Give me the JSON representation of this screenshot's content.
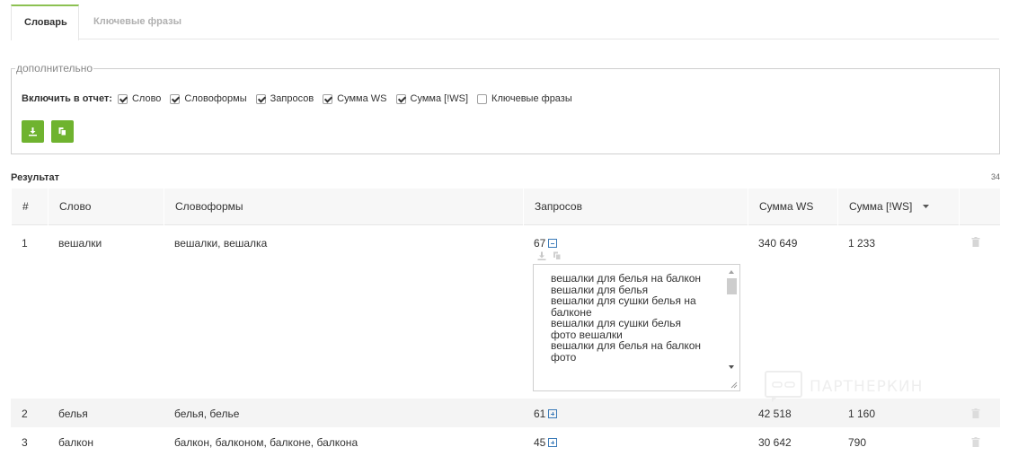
{
  "tabs": [
    {
      "label": "Словарь",
      "active": true
    },
    {
      "label": "Ключевые фразы",
      "active": false
    }
  ],
  "options": {
    "legend": "дополнительно",
    "include_label": "Включить в отчет:",
    "checkboxes": [
      {
        "label": "Слово",
        "checked": true
      },
      {
        "label": "Словоформы",
        "checked": true
      },
      {
        "label": "Запросов",
        "checked": true
      },
      {
        "label": "Сумма WS",
        "checked": true
      },
      {
        "label": "Сумма [!WS]",
        "checked": true
      },
      {
        "label": "Ключевые фразы",
        "checked": false
      }
    ],
    "buttons": [
      {
        "icon": "download-icon"
      },
      {
        "icon": "copy-icon"
      }
    ]
  },
  "result": {
    "title": "Результат",
    "count": "34"
  },
  "table": {
    "headers": [
      "#",
      "Слово",
      "Словоформы",
      "Запросов",
      "Сумма WS",
      "Сумма [!WS]"
    ],
    "sort_icon": "sort-desc-icon",
    "rows": [
      {
        "num": "1",
        "word": "вешалки",
        "forms": "вешалки, вешалка",
        "queries": "67",
        "expanded": true,
        "ws": "340 649",
        "ws_excl": "1 233"
      },
      {
        "num": "2",
        "word": "белья",
        "forms": "белья, белье",
        "queries": "61",
        "expanded": false,
        "ws": "42 518",
        "ws_excl": "1 160"
      },
      {
        "num": "3",
        "word": "балкон",
        "forms": "балкон, балконом, балконе, балкона",
        "queries": "45",
        "expanded": false,
        "ws": "30 642",
        "ws_excl": "790"
      }
    ],
    "phrases": [
      "вешалки для белья на балкон",
      "вешалки для белья",
      "вешалки для сушки белья на балконе",
      "вешалки для сушки белья",
      "фото вешалки",
      "вешалки для белья на балкон фото"
    ]
  },
  "watermark": "ПАРТНЕРКИН",
  "colors": {
    "accent_green": "#6fb32f",
    "tab_active_border": "#8cc152",
    "link_blue": "#3a7ab8"
  }
}
